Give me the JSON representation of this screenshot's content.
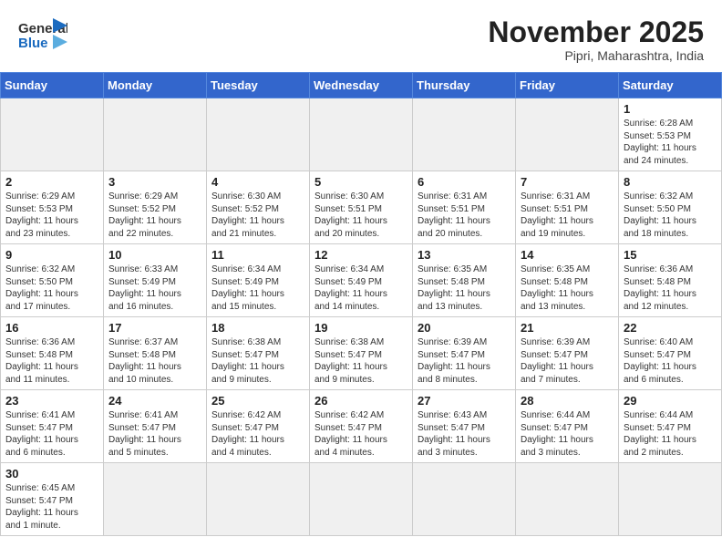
{
  "header": {
    "logo_general": "General",
    "logo_blue": "Blue",
    "month": "November 2025",
    "location": "Pipri, Maharashtra, India"
  },
  "days_of_week": [
    "Sunday",
    "Monday",
    "Tuesday",
    "Wednesday",
    "Thursday",
    "Friday",
    "Saturday"
  ],
  "weeks": [
    [
      {
        "day": "",
        "info": ""
      },
      {
        "day": "",
        "info": ""
      },
      {
        "day": "",
        "info": ""
      },
      {
        "day": "",
        "info": ""
      },
      {
        "day": "",
        "info": ""
      },
      {
        "day": "",
        "info": ""
      },
      {
        "day": "1",
        "info": "Sunrise: 6:28 AM\nSunset: 5:53 PM\nDaylight: 11 hours\nand 24 minutes."
      }
    ],
    [
      {
        "day": "2",
        "info": "Sunrise: 6:29 AM\nSunset: 5:53 PM\nDaylight: 11 hours\nand 23 minutes."
      },
      {
        "day": "3",
        "info": "Sunrise: 6:29 AM\nSunset: 5:52 PM\nDaylight: 11 hours\nand 22 minutes."
      },
      {
        "day": "4",
        "info": "Sunrise: 6:30 AM\nSunset: 5:52 PM\nDaylight: 11 hours\nand 21 minutes."
      },
      {
        "day": "5",
        "info": "Sunrise: 6:30 AM\nSunset: 5:51 PM\nDaylight: 11 hours\nand 20 minutes."
      },
      {
        "day": "6",
        "info": "Sunrise: 6:31 AM\nSunset: 5:51 PM\nDaylight: 11 hours\nand 20 minutes."
      },
      {
        "day": "7",
        "info": "Sunrise: 6:31 AM\nSunset: 5:51 PM\nDaylight: 11 hours\nand 19 minutes."
      },
      {
        "day": "8",
        "info": "Sunrise: 6:32 AM\nSunset: 5:50 PM\nDaylight: 11 hours\nand 18 minutes."
      }
    ],
    [
      {
        "day": "9",
        "info": "Sunrise: 6:32 AM\nSunset: 5:50 PM\nDaylight: 11 hours\nand 17 minutes."
      },
      {
        "day": "10",
        "info": "Sunrise: 6:33 AM\nSunset: 5:49 PM\nDaylight: 11 hours\nand 16 minutes."
      },
      {
        "day": "11",
        "info": "Sunrise: 6:34 AM\nSunset: 5:49 PM\nDaylight: 11 hours\nand 15 minutes."
      },
      {
        "day": "12",
        "info": "Sunrise: 6:34 AM\nSunset: 5:49 PM\nDaylight: 11 hours\nand 14 minutes."
      },
      {
        "day": "13",
        "info": "Sunrise: 6:35 AM\nSunset: 5:48 PM\nDaylight: 11 hours\nand 13 minutes."
      },
      {
        "day": "14",
        "info": "Sunrise: 6:35 AM\nSunset: 5:48 PM\nDaylight: 11 hours\nand 13 minutes."
      },
      {
        "day": "15",
        "info": "Sunrise: 6:36 AM\nSunset: 5:48 PM\nDaylight: 11 hours\nand 12 minutes."
      }
    ],
    [
      {
        "day": "16",
        "info": "Sunrise: 6:36 AM\nSunset: 5:48 PM\nDaylight: 11 hours\nand 11 minutes."
      },
      {
        "day": "17",
        "info": "Sunrise: 6:37 AM\nSunset: 5:48 PM\nDaylight: 11 hours\nand 10 minutes."
      },
      {
        "day": "18",
        "info": "Sunrise: 6:38 AM\nSunset: 5:47 PM\nDaylight: 11 hours\nand 9 minutes."
      },
      {
        "day": "19",
        "info": "Sunrise: 6:38 AM\nSunset: 5:47 PM\nDaylight: 11 hours\nand 9 minutes."
      },
      {
        "day": "20",
        "info": "Sunrise: 6:39 AM\nSunset: 5:47 PM\nDaylight: 11 hours\nand 8 minutes."
      },
      {
        "day": "21",
        "info": "Sunrise: 6:39 AM\nSunset: 5:47 PM\nDaylight: 11 hours\nand 7 minutes."
      },
      {
        "day": "22",
        "info": "Sunrise: 6:40 AM\nSunset: 5:47 PM\nDaylight: 11 hours\nand 6 minutes."
      }
    ],
    [
      {
        "day": "23",
        "info": "Sunrise: 6:41 AM\nSunset: 5:47 PM\nDaylight: 11 hours\nand 6 minutes."
      },
      {
        "day": "24",
        "info": "Sunrise: 6:41 AM\nSunset: 5:47 PM\nDaylight: 11 hours\nand 5 minutes."
      },
      {
        "day": "25",
        "info": "Sunrise: 6:42 AM\nSunset: 5:47 PM\nDaylight: 11 hours\nand 4 minutes."
      },
      {
        "day": "26",
        "info": "Sunrise: 6:42 AM\nSunset: 5:47 PM\nDaylight: 11 hours\nand 4 minutes."
      },
      {
        "day": "27",
        "info": "Sunrise: 6:43 AM\nSunset: 5:47 PM\nDaylight: 11 hours\nand 3 minutes."
      },
      {
        "day": "28",
        "info": "Sunrise: 6:44 AM\nSunset: 5:47 PM\nDaylight: 11 hours\nand 3 minutes."
      },
      {
        "day": "29",
        "info": "Sunrise: 6:44 AM\nSunset: 5:47 PM\nDaylight: 11 hours\nand 2 minutes."
      }
    ],
    [
      {
        "day": "30",
        "info": "Sunrise: 6:45 AM\nSunset: 5:47 PM\nDaylight: 11 hours\nand 1 minute."
      },
      {
        "day": "",
        "info": ""
      },
      {
        "day": "",
        "info": ""
      },
      {
        "day": "",
        "info": ""
      },
      {
        "day": "",
        "info": ""
      },
      {
        "day": "",
        "info": ""
      },
      {
        "day": "",
        "info": ""
      }
    ]
  ]
}
